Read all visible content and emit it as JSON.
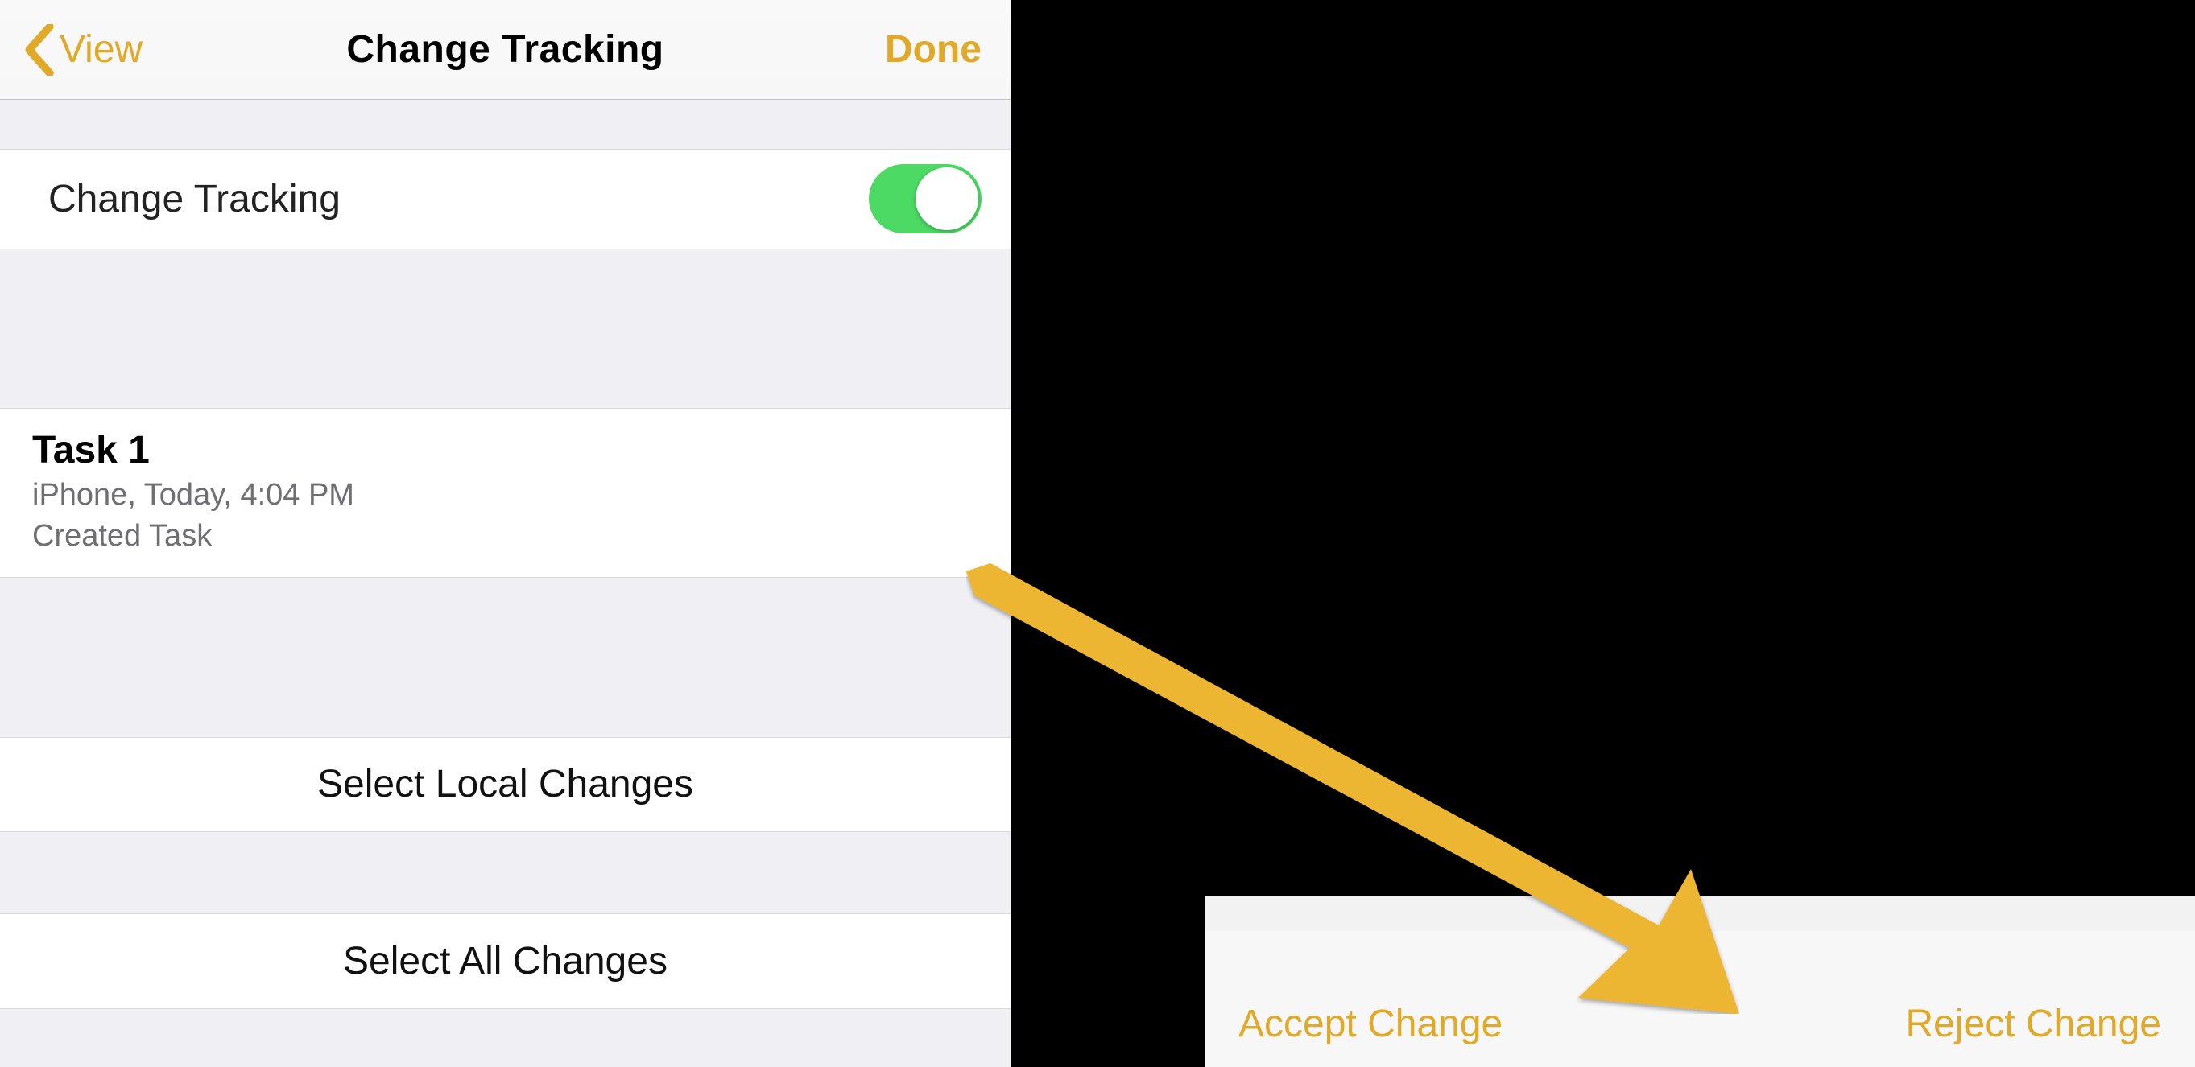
{
  "navbar": {
    "back_label": "View",
    "title": "Change Tracking",
    "done_label": "Done"
  },
  "toggle_row": {
    "label": "Change Tracking",
    "on": true
  },
  "changes": [
    {
      "title": "Task 1",
      "meta": "iPhone, Today, 4:04 PM",
      "desc": "Created Task"
    }
  ],
  "actions": {
    "select_local": "Select Local Changes",
    "select_all": "Select All Changes"
  },
  "toolbar": {
    "accept": "Accept Change",
    "reject": "Reject Change"
  },
  "accent_color": "#E0A928"
}
